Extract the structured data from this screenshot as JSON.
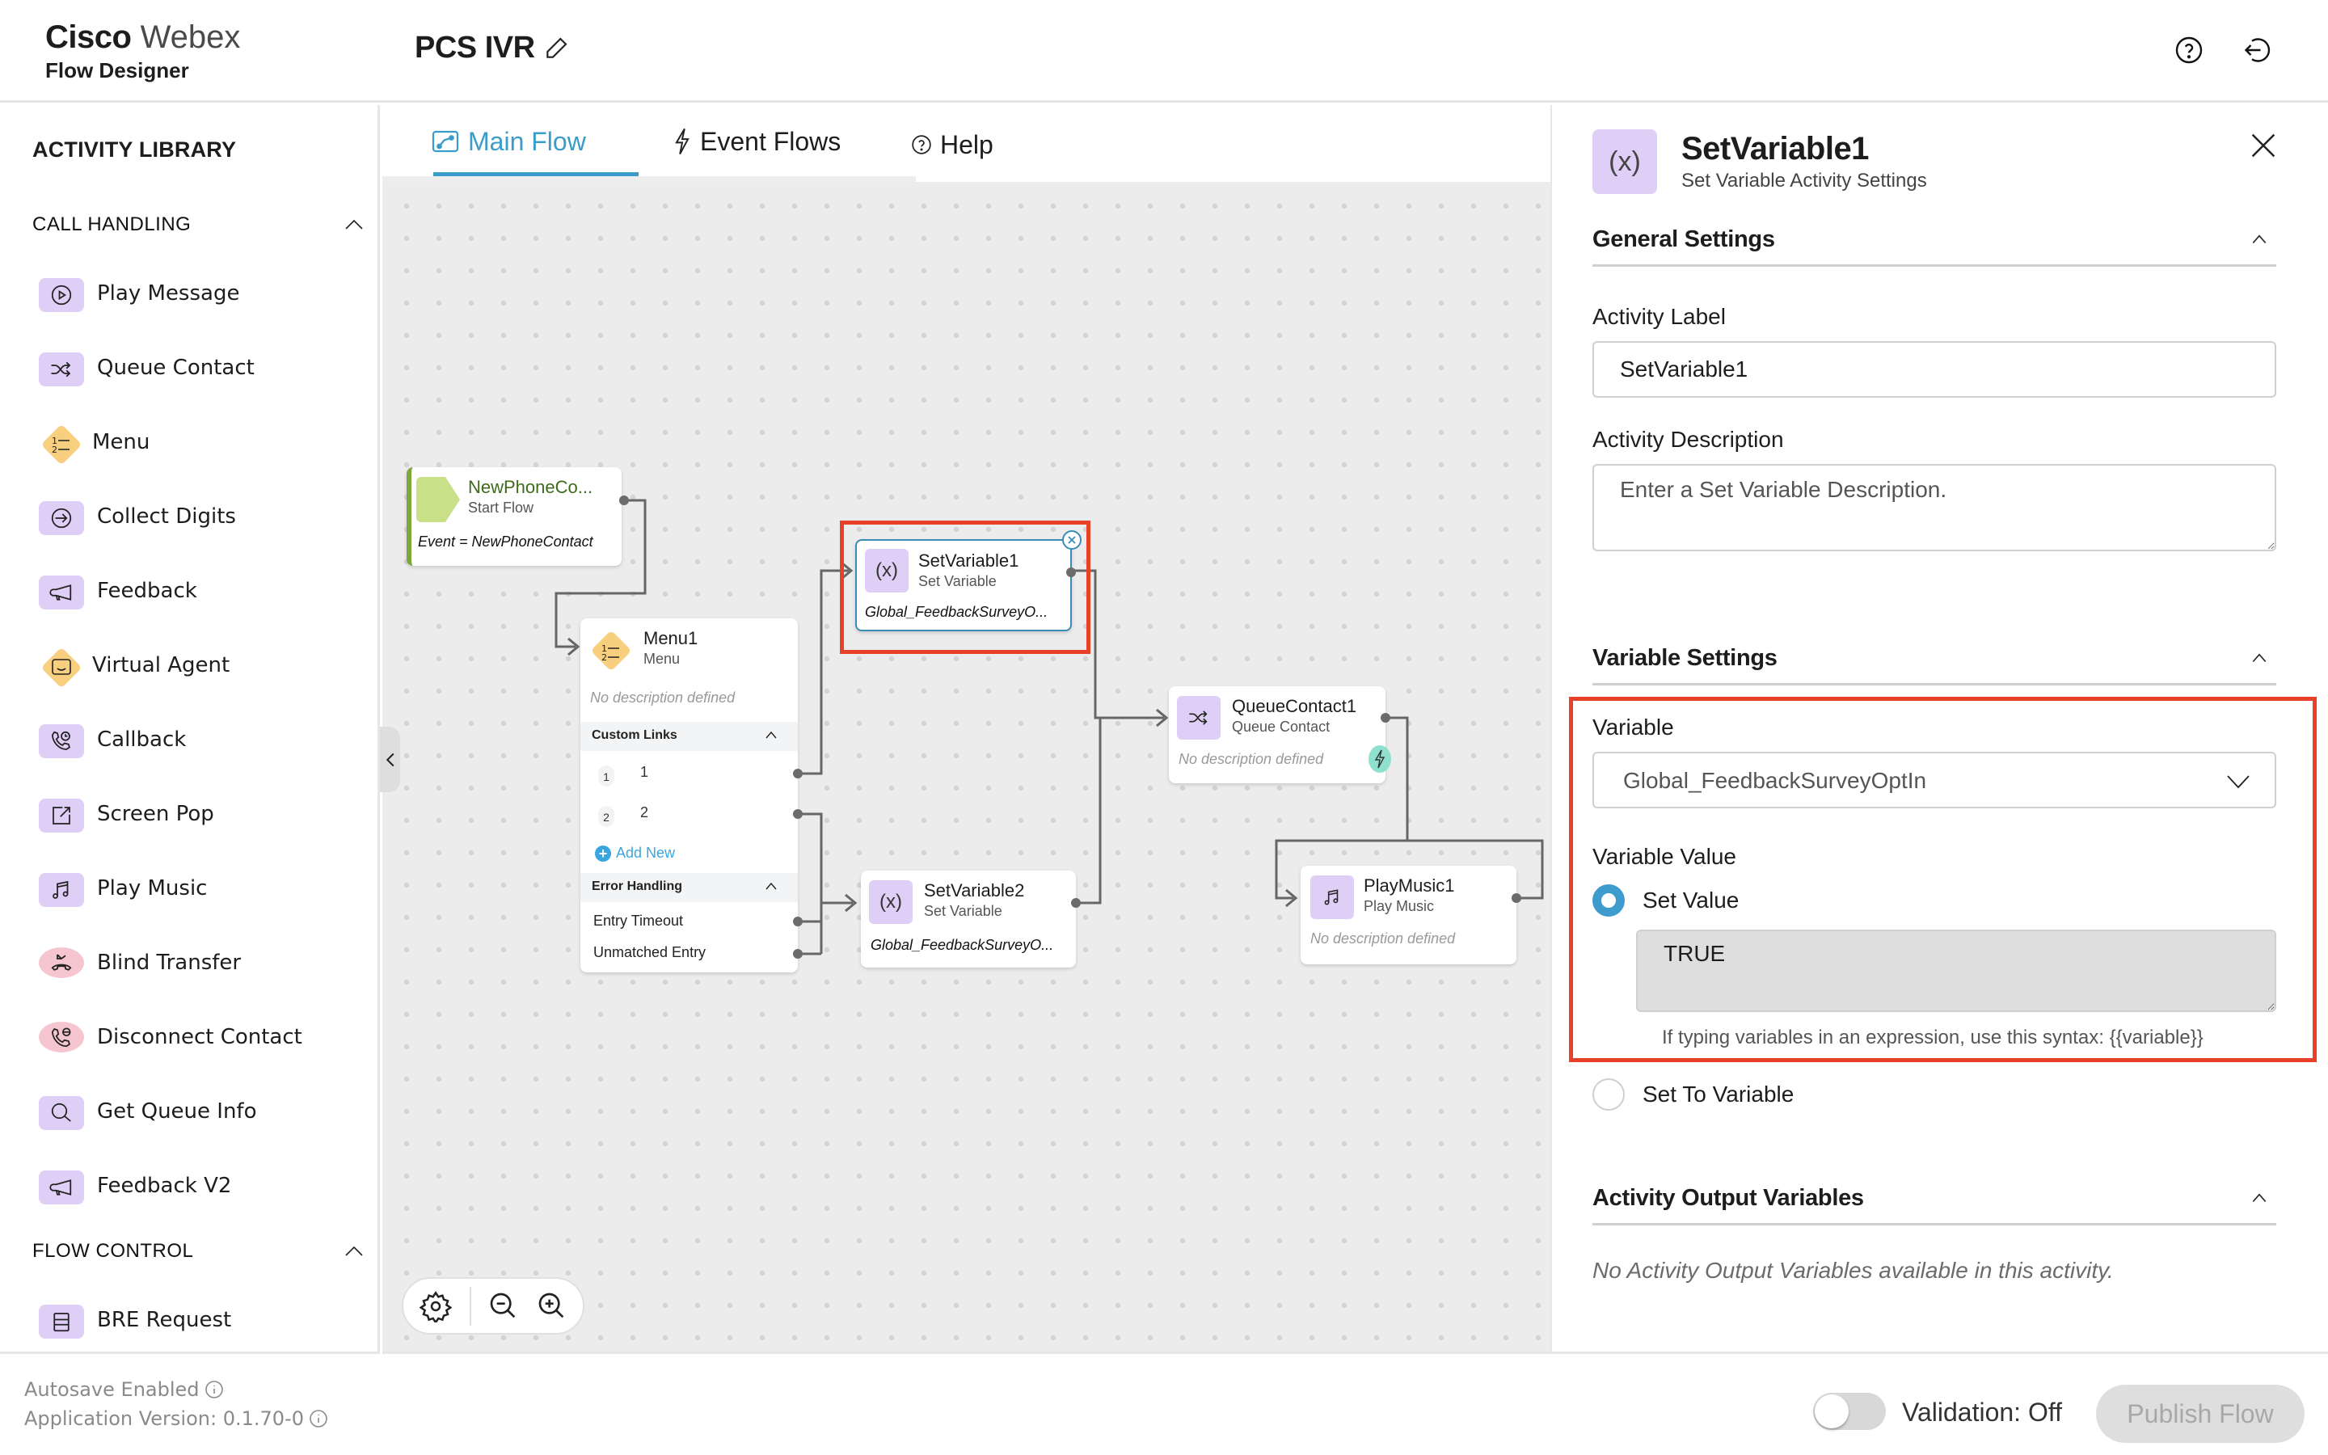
{
  "header": {
    "brand_bold": "Cisco",
    "brand_light": "Webex",
    "product": "Flow Designer",
    "flow_name": "PCS IVR"
  },
  "sidebar": {
    "title": "ACTIVITY LIBRARY",
    "categories": [
      {
        "label": "CALL HANDLING",
        "items": [
          {
            "label": "Play Message",
            "icon": "play-circle-icon"
          },
          {
            "label": "Queue Contact",
            "icon": "shuffle-icon"
          },
          {
            "label": "Menu",
            "icon": "numbered-list-icon"
          },
          {
            "label": "Collect Digits",
            "icon": "arrow-right-circle-icon"
          },
          {
            "label": "Feedback",
            "icon": "megaphone-icon"
          },
          {
            "label": "Virtual Agent",
            "icon": "bot-face-icon"
          },
          {
            "label": "Callback",
            "icon": "phone-clock-icon"
          },
          {
            "label": "Screen Pop",
            "icon": "external-link-icon"
          },
          {
            "label": "Play Music",
            "icon": "music-note-icon"
          },
          {
            "label": "Blind Transfer",
            "icon": "phone-transfer-icon"
          },
          {
            "label": "Disconnect Contact",
            "icon": "phone-disconnect-icon"
          },
          {
            "label": "Get Queue Info",
            "icon": "search-icon"
          },
          {
            "label": "Feedback V2",
            "icon": "megaphone-icon"
          }
        ]
      },
      {
        "label": "FLOW CONTROL",
        "items": [
          {
            "label": "BRE Request",
            "icon": "server-icon"
          }
        ]
      }
    ],
    "footer": {
      "autosave": "Autosave Enabled",
      "version": "Application Version: 0.1.70-0"
    }
  },
  "tabs": [
    {
      "label": "Main Flow",
      "icon": "flow-icon",
      "active": true
    },
    {
      "label": "Event Flows",
      "icon": "lightning-icon",
      "active": false
    },
    {
      "label": "Help",
      "icon": "help-circle-icon",
      "active": false
    }
  ],
  "canvas": {
    "nodes": {
      "start": {
        "title": "NewPhoneCo...",
        "subtitle": "Start Flow",
        "desc": "Event = NewPhoneContact"
      },
      "menu": {
        "title": "Menu1",
        "subtitle": "Menu",
        "desc": "No description defined",
        "custom_links_label": "Custom Links",
        "links": [
          {
            "badge": "1",
            "label": "1"
          },
          {
            "badge": "2",
            "label": "2"
          }
        ],
        "add_new": "Add New",
        "error_handling_label": "Error Handling",
        "errors": [
          "Entry Timeout",
          "Unmatched Entry"
        ]
      },
      "setvar1": {
        "title": "SetVariable1",
        "subtitle": "Set Variable",
        "desc": "Global_FeedbackSurveyO...",
        "selected": true
      },
      "setvar2": {
        "title": "SetVariable2",
        "subtitle": "Set Variable",
        "desc": "Global_FeedbackSurveyO..."
      },
      "queue": {
        "title": "QueueContact1",
        "subtitle": "Queue Contact",
        "desc": "No description defined"
      },
      "music": {
        "title": "PlayMusic1",
        "subtitle": "Play Music",
        "desc": "No description defined"
      }
    }
  },
  "panel": {
    "title": "SetVariable1",
    "subtitle": "Set Variable Activity Settings",
    "general": {
      "heading": "General Settings",
      "label_field_label": "Activity Label",
      "label_value": "SetVariable1",
      "desc_field_label": "Activity Description",
      "desc_placeholder": "Enter a Set Variable Description."
    },
    "variable": {
      "heading": "Variable Settings",
      "variable_label": "Variable",
      "variable_selected": "Global_FeedbackSurveyOptIn",
      "value_label": "Variable Value",
      "option_set_value": "Set Value",
      "value": "TRUE",
      "hint": "If typing variables in an expression, use this syntax: {{variable}}",
      "option_set_to_variable": "Set To Variable",
      "selected_option": "Set Value"
    },
    "output": {
      "heading": "Activity Output Variables",
      "empty": "No Activity Output Variables available in this activity."
    }
  },
  "footer": {
    "validation_label": "Validation: Off",
    "validation_on": false,
    "publish_label": "Publish Flow"
  },
  "colors": {
    "accent": "#3a9dc9",
    "highlight": "#e8412a",
    "activity_icon_bg": "#dfcff7",
    "menu_icon_bg": "#f7cf7e",
    "start_green": "#c8e087"
  }
}
